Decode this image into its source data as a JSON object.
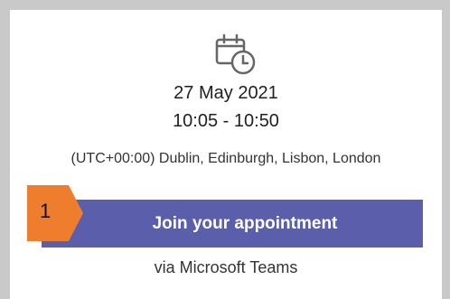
{
  "appointment": {
    "icon": "calendar-clock-icon",
    "date": "27 May 2021",
    "time": "10:05 - 10:50",
    "timezone": "(UTC+00:00) Dublin, Edinburgh, Lisbon, London",
    "join_label": "Join your appointment",
    "via_label": "via Microsoft Teams"
  },
  "callout": {
    "number": "1",
    "color": "#ee7d2e"
  },
  "colors": {
    "button": "#5b5fab",
    "background": "#c9c9c9",
    "card": "#ffffff"
  }
}
